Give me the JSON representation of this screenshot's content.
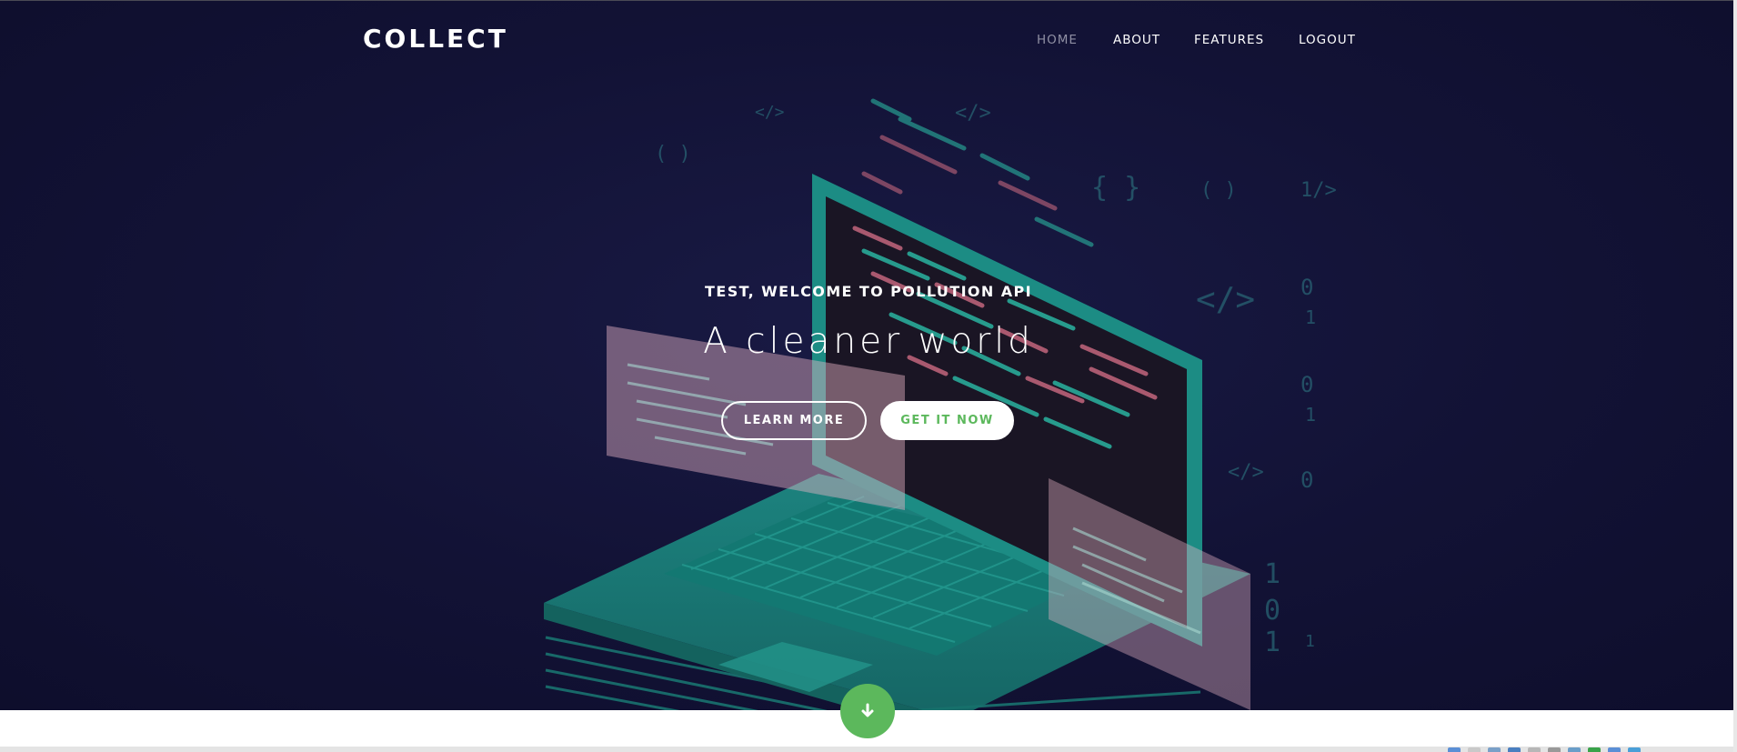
{
  "navbar": {
    "brand": "COLLECT",
    "items": [
      {
        "label": "HOME",
        "active": true
      },
      {
        "label": "ABOUT",
        "active": false
      },
      {
        "label": "FEATURES",
        "active": false
      },
      {
        "label": "LOGOUT",
        "active": false
      }
    ]
  },
  "hero": {
    "subtitle": "TEST, WELCOME TO POLLUTION API",
    "title": "A cleaner world",
    "buttons": {
      "learn_more": "LEARN MORE",
      "get_it_now": "GET IT NOW"
    },
    "scroll_icon": "arrow-down-icon"
  },
  "colors": {
    "hero_background": "#131336",
    "accent_green": "#5cb85c",
    "teal_art": "#1f8f86",
    "white": "#ffffff",
    "nav_active": "#8f8fa3"
  }
}
